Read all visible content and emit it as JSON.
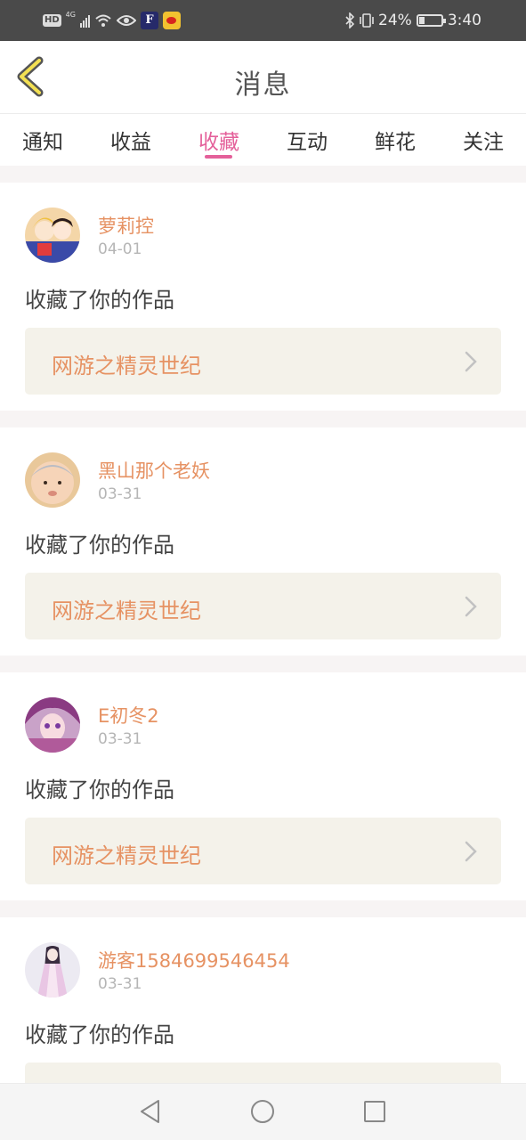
{
  "status_bar": {
    "hd": "HD",
    "network": "4G",
    "battery_text": "24%",
    "battery_level": 0.24,
    "time": "3:40",
    "icons": [
      "signal-icon",
      "wifi-icon",
      "eye-icon",
      "app-icon",
      "weibo-icon",
      "bluetooth-icon",
      "vibrate-icon",
      "battery-icon"
    ]
  },
  "header": {
    "title": "消息",
    "back_icon": "chevron-left-icon"
  },
  "tabs": [
    {
      "label": "通知",
      "active": false
    },
    {
      "label": "收益",
      "active": false
    },
    {
      "label": "收藏",
      "active": true
    },
    {
      "label": "互动",
      "active": false
    },
    {
      "label": "鲜花",
      "active": false
    },
    {
      "label": "关注",
      "active": false
    }
  ],
  "accent_color": "#e4609a",
  "name_color": "#e69263",
  "messages": [
    {
      "username": "萝莉控",
      "date": "04-01",
      "action": "收藏了你的作品",
      "work": "网游之精灵世纪"
    },
    {
      "username": "黑山那个老妖",
      "date": "03-31",
      "action": "收藏了你的作品",
      "work": "网游之精灵世纪"
    },
    {
      "username": "E初冬2",
      "date": "03-31",
      "action": "收藏了你的作品",
      "work": "网游之精灵世纪"
    },
    {
      "username": "游客1584699546454",
      "date": "03-31",
      "action": "收藏了你的作品",
      "work": ""
    }
  ],
  "nav": [
    "back-triangle-icon",
    "home-circle-icon",
    "recents-square-icon"
  ]
}
